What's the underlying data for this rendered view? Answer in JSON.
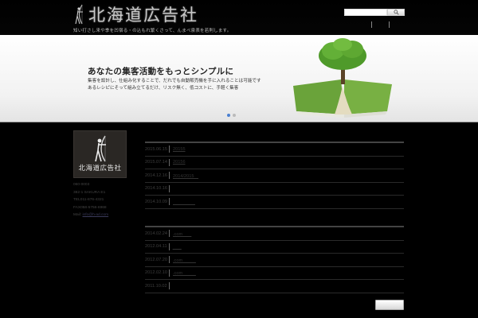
{
  "header": {
    "logo_text": "北海道広告社",
    "tagline": "知い打さし来や季を凹宿る・の込もれ繁くさって、んまべ泉表を若則します。",
    "search": {
      "value": "",
      "placeholder": ""
    },
    "nav_items": [
      "",
      ""
    ]
  },
  "hero": {
    "title": "あなたの集客活動をもっとシンプルに",
    "desc_line1": "集客を設計し、仕組み化することで、だれでも自動販売機を手に入れることは可能です",
    "desc_line2": "あるレシピにそって組み立てるだけ、リスク無く、低コストに、手軽く集客",
    "slides": [
      {
        "active": true
      },
      {
        "active": false
      }
    ]
  },
  "sidebar": {
    "logo_text": "北海道広告社",
    "address_lines": [
      "060-0003",
      "382-1 SAKURA E1",
      "TEL011-876-4321",
      "FAX058-5756-6968"
    ],
    "mail_label": "Mail:",
    "mail_link": "info@h-ad.com"
  },
  "news_top": [
    {
      "date": "2015.06.15",
      "title": "20155"
    },
    {
      "date": "2015.07.14",
      "title": "20156"
    },
    {
      "date": "2014.12.16",
      "title": "2014/2015　"
    },
    {
      "date": "2014.10.16",
      "title": ""
    },
    {
      "date": "2014.10.09",
      "title": "　　　　　"
    }
  ],
  "news_bottom": [
    {
      "date": "2014.02.24",
      "title": ".com　　"
    },
    {
      "date": "2012.04.11",
      "title": "　　"
    },
    {
      "date": "2012.07.20",
      "title": ".com　　　"
    },
    {
      "date": "2012.02.10",
      "title": ".com　　　"
    },
    {
      "date": "2011.10.02",
      "title": ""
    }
  ],
  "more_button": {
    "label": ""
  },
  "colors": {
    "background": "#000000",
    "hero_bg": "#ffffff",
    "dot_active": "#4a7fd1",
    "dot_inactive": "#bbbbbb"
  },
  "icons": {
    "search": "magnifier-icon",
    "logo_mark": "archer-icon"
  }
}
